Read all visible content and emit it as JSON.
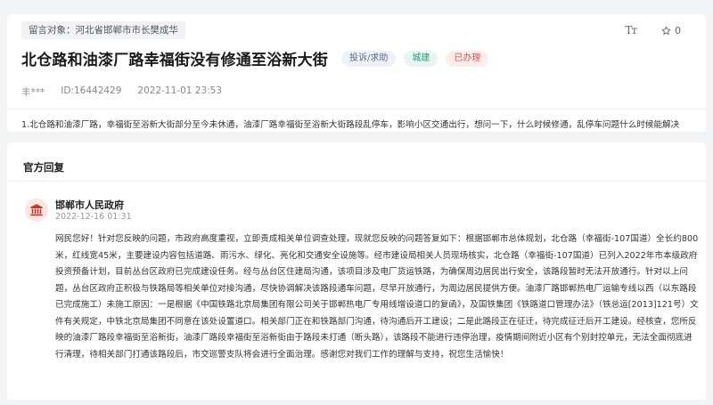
{
  "petition": {
    "target_label": "留言对象：",
    "target_value": "河北省邯郸市市长樊成华",
    "title": "北仓路和油漆厂路幸福街没有修通至浴新大街",
    "tags": {
      "type": "投诉/求助",
      "category": "城建",
      "status": "已办理"
    },
    "author": "丰***",
    "id_text": "ID:16442429",
    "timestamp": "2022-11-01 23:53",
    "body": "1.北仓路和油漆厂路，幸福街至浴新大街部分至今未休通，油漆厂路幸福街至浴新大街路段乱停车，影响小区交通出行，想问一下，什么时候修通，乱停车问题什么时候能解决"
  },
  "toolbar": {
    "font_size_icon": "text-size-icon",
    "font_size_glyph": "Tт",
    "favorite_icon": "star-icon",
    "favorite_count": "0"
  },
  "reply": {
    "section_title": "官方回复",
    "responder_icon": "government-building-icon",
    "responder": "邯郸市人民政府",
    "time": "2022-12-16 01:31",
    "body": "网民您好！针对您反映的问题，市政府高度重视，立即责成相关单位调查处理，现就您反映的问题答复如下：根据邯郸市总体规划，北仓路（幸福街-107国道）全长约800米，红线宽45米，主要建设内容包括道路、雨污水、绿化、亮化和交通安全设施等。经市建设局相关人员现场核实，北仓路（幸福街-107国道）已列入2022年市本级政府投资预备计划，目前丛台区政府已完成建设任务。经与丛台区住建局沟通，该项目涉及电厂货运铁路，为确保周边居民出行安全，该路段暂时无法开放通行。针对以上问题，丛台区政府正积极与铁路局等相关单位对接沟通，尽快协调解决该路段通车问题，尽早开放通行，为周边居民提供方便。油漆厂路邯郸热电厂运输专线以西（以东路段已完成施工）未施工原因：一是根据《中国铁路北京局集团有限公司关于邯郸热电厂专用线增设道口的复函》，及国铁集团《铁路道口管理办法》（铁总运[2013]121号）文件有关规定，中铁北京局集团不同意在该处设置道口。相关部门正在和铁路部门沟通，待沟通后开工建设；二是此路段正在征迁，待完成征迁后开工建设。经核查，您所反映的油漆厂路段幸福街至浴新街，油漆厂路段幸福街至浴新街由于路段未打通（断头路），该路段不能进行违停治理，疫情期间附近小区有个别封控单元，无法全面彻底进行清理，待相关部门打通该路段后，市交巡警支队将会进行全面治理。感谢您对我们工作的理解与支持，祝您生活愉快！"
  },
  "colors": {
    "page_bg": "#f2f3f5",
    "card_bg": "#ffffff",
    "tag_type_text": "#5a6c8a",
    "tag_category_text": "#2e9a7f",
    "tag_status_text": "#d9534f",
    "responder_icon": "#c0392b"
  }
}
